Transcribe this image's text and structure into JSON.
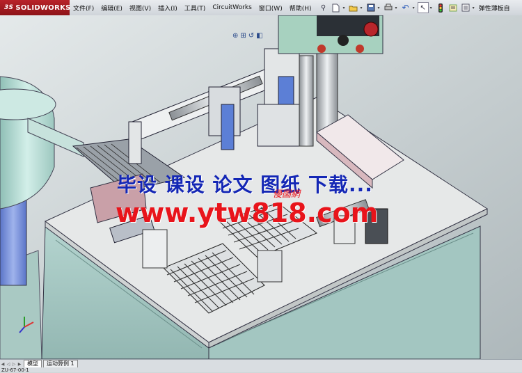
{
  "app": {
    "logo_text": "SOLIDWORKS",
    "logo_mark": "3S",
    "document_title": "弹性薄板自"
  },
  "menu": [
    "文件(F)",
    "编辑(E)",
    "视图(V)",
    "插入(I)",
    "工具(T)",
    "CircuitWorks",
    "窗口(W)",
    "帮助(H)"
  ],
  "toolbar": {
    "icons": [
      "pin-icon",
      "new-document-icon",
      "open-icon",
      "save-icon",
      "print-icon",
      "undo-icon",
      "select-arrow-icon",
      "rebuild-icon",
      "file-properties-icon",
      "options-icon"
    ]
  },
  "view_toolbar": {
    "icons": [
      "zoom-to-fit-icon",
      "zoom-area-icon",
      "previous-view-icon",
      "section-view-icon"
    ]
  },
  "watermark": {
    "line1": "毕设 课设 论文 图纸 下载...",
    "line2": "www.ytw818.com",
    "brand": "優圖網"
  },
  "tabs": [
    "模型",
    "运动算例 1"
  ],
  "status_text": "ZU-67-00-1",
  "colors": {
    "logo_red": "#b8232a",
    "table_top": "#e6e8e8",
    "cabinet_green": "#a9cbc8",
    "feeder_bowl": "#b8dcd4",
    "watermark_blue": "#1427b5",
    "watermark_red": "#e8141b"
  }
}
